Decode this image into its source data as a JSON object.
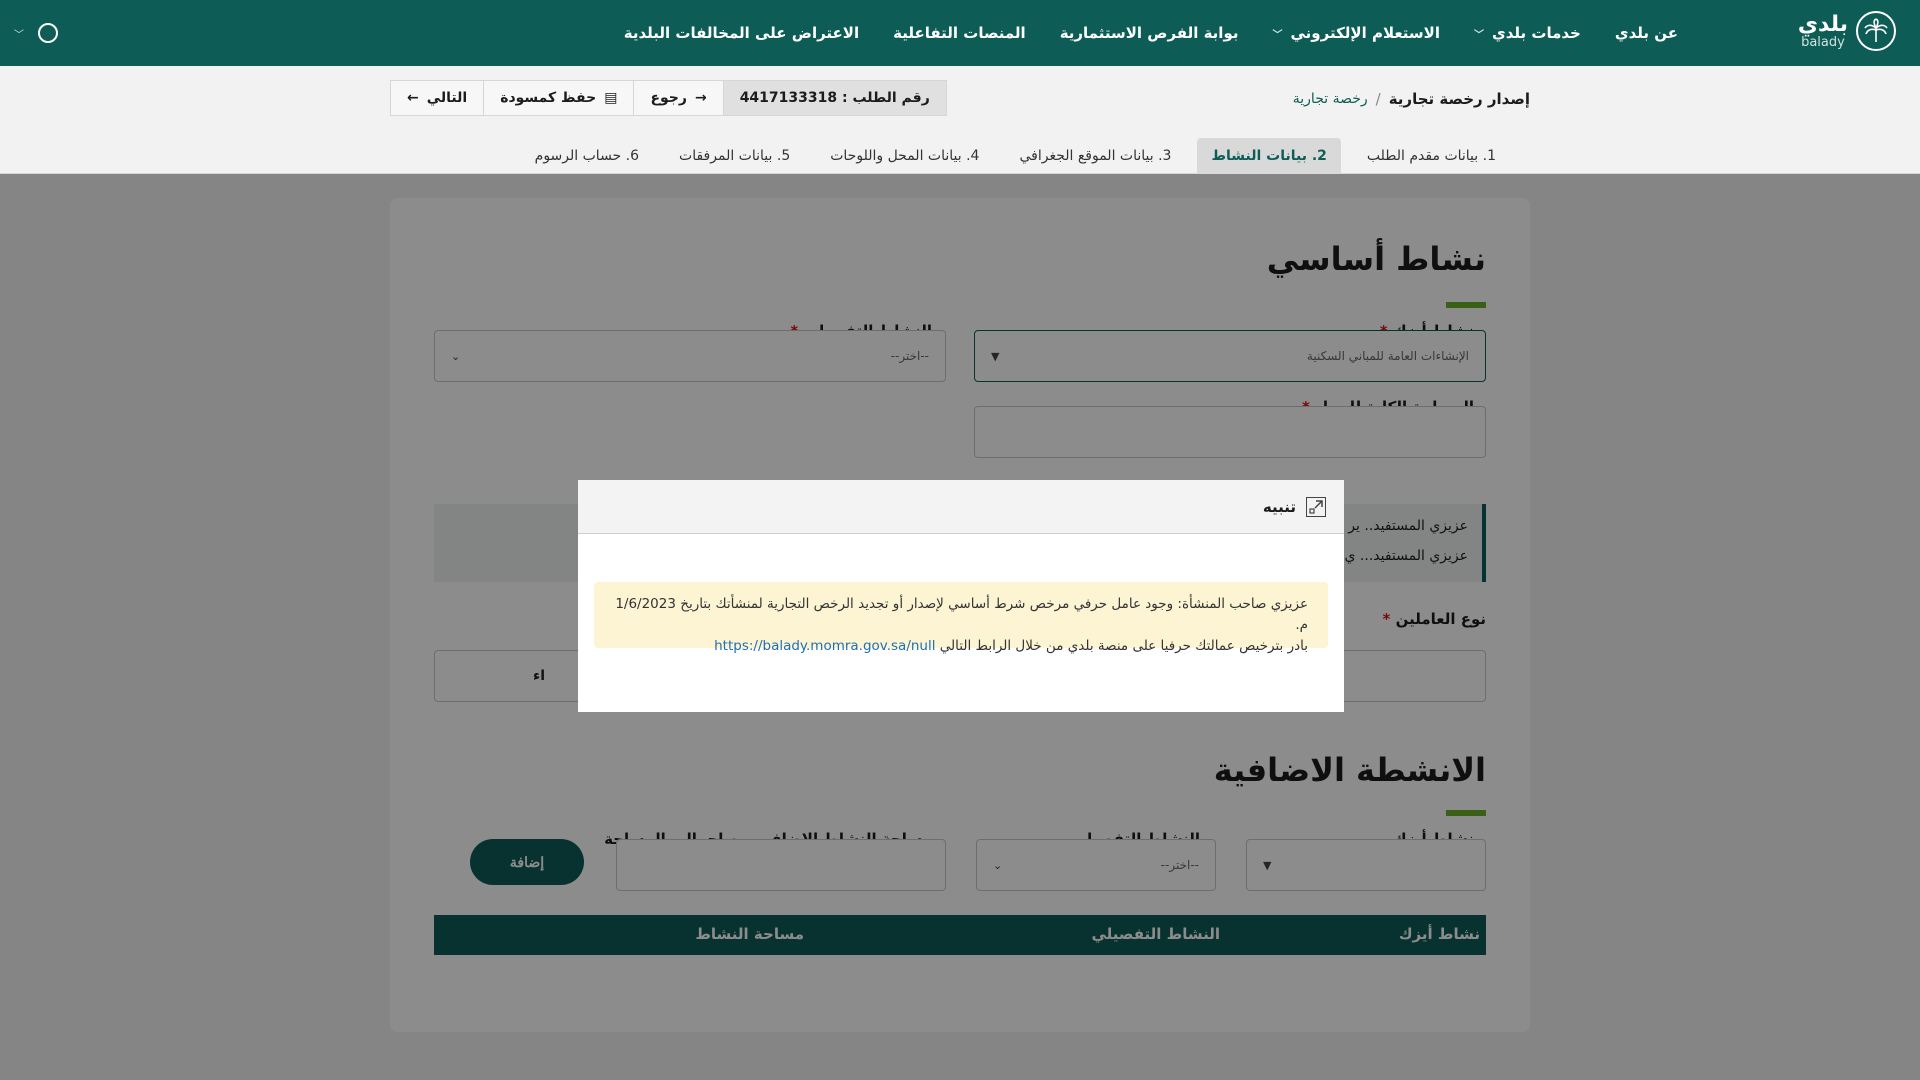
{
  "nav": {
    "logo_ar": "بلدي",
    "logo_en": "balady",
    "items": [
      {
        "label": "عن بلدي",
        "chevron": false
      },
      {
        "label": "خدمات بلدي",
        "chevron": true
      },
      {
        "label": "الاستعلام الإلكتروني",
        "chevron": true
      },
      {
        "label": "بوابة الفرص الاستثمارية",
        "chevron": false
      },
      {
        "label": "المنصات التفاعلية",
        "chevron": false
      },
      {
        "label": "الاعتراض على المخالفات البلدية",
        "chevron": false
      }
    ]
  },
  "header": {
    "breadcrumb_current": "إصدار رخصة تجارية",
    "breadcrumb_separator": "/",
    "breadcrumb_link": "رخصة تجارية",
    "request_number": "رقم الطلب : 4417133318",
    "back_label": "رجوع",
    "save_draft_label": "حفظ كمسودة",
    "next_label": "التالي"
  },
  "steps": [
    {
      "label": "1. بيانات مقدم الطلب",
      "active": false
    },
    {
      "label": "2. بيانات النشاط",
      "active": true
    },
    {
      "label": "3. بيانات الموقع الجغرافي",
      "active": false
    },
    {
      "label": "4. بيانات المحل واللوحات",
      "active": false
    },
    {
      "label": "5. بيانات المرفقات",
      "active": false
    },
    {
      "label": "6. حساب الرسوم",
      "active": false
    }
  ],
  "main_activity": {
    "title": "نشاط أساسي",
    "isic_label": "نشاط أيزك",
    "isic_value": "الإنشاءات العامة للمباني السكنية",
    "detailed_label": "النشاط التفصيلي",
    "detailed_placeholder": "--اختر--",
    "area_label": "المساحة الكلية للمحل",
    "info_line_1": "عزيزي المستفيد.. ير",
    "info_line_2": "عزيزي المستفيد... ي",
    "workers_label": "نوع العاملين",
    "workers_partial": "اء"
  },
  "additional": {
    "title": "الانشطة الاضافية",
    "isic_label": "نشاط أيزك",
    "detailed_label": "النشاط التفصيلي",
    "detailed_placeholder": "--اختر--",
    "area_label": "مساحة النشاط الإضافي من إجمالي المساحة",
    "add_button": "إضافة",
    "table_headers": [
      "نشاط أيزك",
      "النشاط التفصيلي",
      "مساحة النشاط"
    ]
  },
  "modal": {
    "title": "تنبيه",
    "message_line_1": "عزيزي صاحب المنشأة: وجود عامل حرفي مرخص شرط أساسي لإصدار أو تجديد الرخص التجارية لمنشأتك بتاريخ 1/6/2023 م.",
    "message_line_2": "بادر بترخيص عمالتك حرفيا على منصة بلدي من خلال الرابط التالي",
    "link": "https://balady.momra.gov.sa/null"
  },
  "colors": {
    "brand": "#0e5c56",
    "accent": "#6ab02b",
    "alert_bg": "#fdf4d3"
  }
}
